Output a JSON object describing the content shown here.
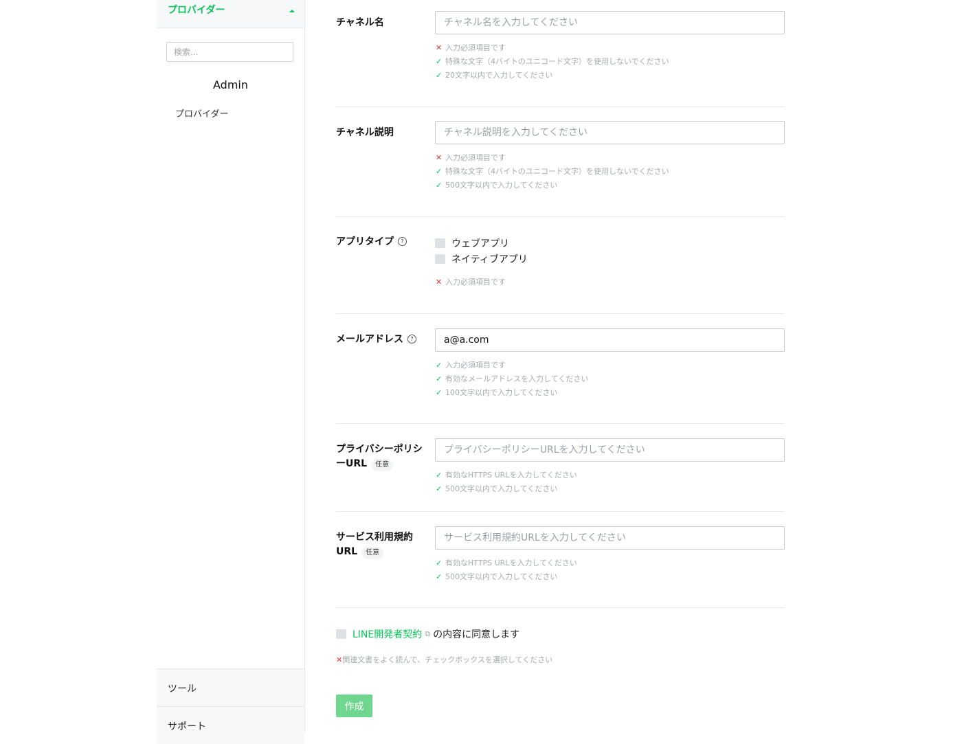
{
  "sidebar": {
    "provider_header": "プロバイダー",
    "search_placeholder": "検索...",
    "admin_name": "Admin",
    "provider_item": "プロバイダー",
    "tools_label": "ツール",
    "support_label": "サポート"
  },
  "form": {
    "channel_name": {
      "label": "チャネル名",
      "placeholder": "チャネル名を入力してください",
      "rules": [
        {
          "status": "error",
          "text": "入力必須項目です"
        },
        {
          "status": "ok",
          "text": "特殊な文字（4バイトのユニコード文字）を使用しないでください"
        },
        {
          "status": "ok",
          "text": "20文字以内で入力してください"
        }
      ]
    },
    "channel_description": {
      "label": "チャネル説明",
      "placeholder": "チャネル説明を入力してください",
      "rules": [
        {
          "status": "error",
          "text": "入力必須項目です"
        },
        {
          "status": "ok",
          "text": "特殊な文字（4バイトのユニコード文字）を使用しないでください"
        },
        {
          "status": "ok",
          "text": "500文字以内で入力してください"
        }
      ]
    },
    "app_type": {
      "label": "アプリタイプ",
      "options": [
        "ウェブアプリ",
        "ネイティブアプリ"
      ],
      "rules": [
        {
          "status": "error",
          "text": "入力必須項目です"
        }
      ]
    },
    "email": {
      "label": "メールアドレス",
      "value": "a@a.com",
      "rules": [
        {
          "status": "ok",
          "text": "入力必須項目です"
        },
        {
          "status": "ok",
          "text": "有効なメールアドレスを入力してください"
        },
        {
          "status": "ok",
          "text": "100文字以内で入力してください"
        }
      ]
    },
    "privacy_url": {
      "label_line1": "プライバシーポリシ",
      "label_line2": "ーURL",
      "optional": "任意",
      "placeholder": "プライバシーポリシーURLを入力してください",
      "rules": [
        {
          "status": "ok",
          "text": "有効なHTTPS URLを入力してください"
        },
        {
          "status": "ok",
          "text": "500文字以内で入力してください"
        }
      ]
    },
    "terms_url": {
      "label_line1": "サービス利用規約",
      "label_line2": "URL",
      "optional": "任意",
      "placeholder": "サービス利用規約URLを入力してください",
      "rules": [
        {
          "status": "ok",
          "text": "有効なHTTPS URLを入力してください"
        },
        {
          "status": "ok",
          "text": "500文字以内で入力してください"
        }
      ]
    },
    "agreement": {
      "link_text": "LINE開発者契約",
      "suffix": "の内容に同意します",
      "error": "関連文書をよく読んで、チェックボックスを選択してください"
    },
    "create_button": "作成"
  },
  "icons": {
    "ok": "✓",
    "error": "✕",
    "help": "?",
    "external_link": "⧉"
  },
  "colors": {
    "accent": "#06c755",
    "error": "#e1392b",
    "button_disabled": "#6fd68f"
  }
}
